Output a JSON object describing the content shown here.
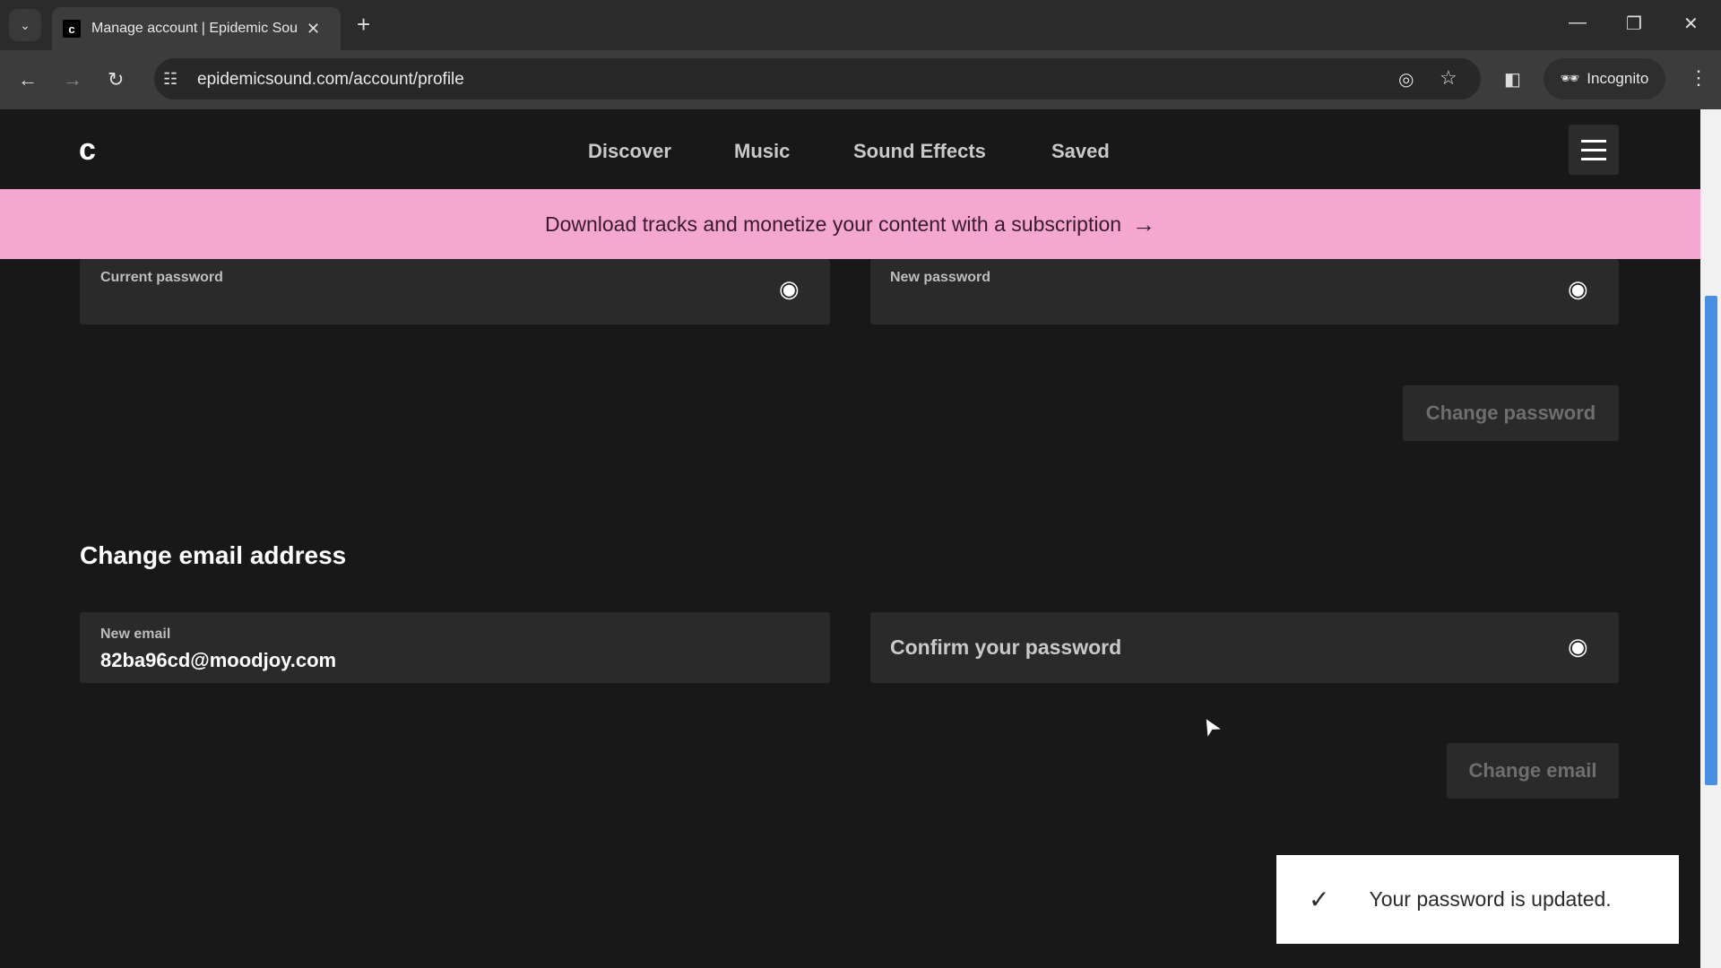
{
  "browser": {
    "tab_title": "Manage account | Epidemic Sou",
    "url": "epidemicsound.com/account/profile",
    "incognito_label": "Incognito"
  },
  "header": {
    "nav": [
      "Discover",
      "Music",
      "Sound Effects",
      "Saved"
    ]
  },
  "banner": {
    "text": "Download tracks and monetize your content with a subscription",
    "arrow": "→",
    "color": "#f4a7cf"
  },
  "password_section": {
    "current_label": "Current password",
    "new_label": "New password",
    "button": "Change password"
  },
  "email_section": {
    "heading": "Change email address",
    "new_email_label": "New email",
    "new_email_value": "82ba96cd@moodjoy.com",
    "confirm_placeholder": "Confirm your password",
    "button": "Change email"
  },
  "toast": {
    "message": "Your password is updated.",
    "icon": "check-icon"
  }
}
